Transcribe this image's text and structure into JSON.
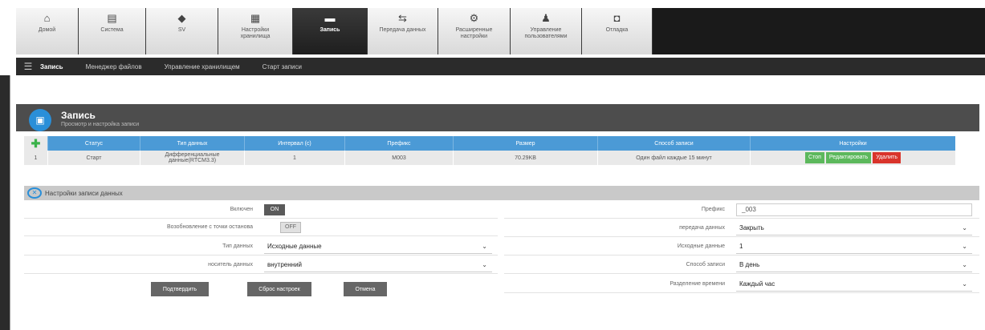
{
  "toolbar": {
    "items": [
      {
        "label": "Домой",
        "icon": "home-icon",
        "glyph": "⌂"
      },
      {
        "label": "Система",
        "icon": "system-icon",
        "glyph": "▤"
      },
      {
        "label": "SV",
        "icon": "sv-icon",
        "glyph": "◆"
      },
      {
        "label": "Настройки хранилища",
        "icon": "storage-icon",
        "glyph": "▦"
      },
      {
        "label": "Запись",
        "icon": "folder-icon",
        "glyph": "▬",
        "active": true
      },
      {
        "label": "Передача данных",
        "icon": "transfer-icon",
        "glyph": "⇆"
      },
      {
        "label": "Расширенные настройки",
        "icon": "settings-icon",
        "glyph": "⚙"
      },
      {
        "label": "Управление пользователями",
        "icon": "users-icon",
        "glyph": "♟"
      },
      {
        "label": "Отладка",
        "icon": "debug-icon",
        "glyph": "◘"
      }
    ]
  },
  "subnav": {
    "items": [
      "Запись",
      "Менеджер файлов",
      "Управление хранилищем",
      "Старт записи"
    ]
  },
  "header": {
    "title": "Запись",
    "subtitle": "Просмотр и настройка записи"
  },
  "table": {
    "columns": [
      "Статус",
      "Тип данных",
      "Интервал (с)",
      "Префикс",
      "Размер",
      "Способ записи",
      "Настройки"
    ],
    "rows": [
      {
        "index": "1",
        "status": "Старт",
        "data_type": "Дифференциальные данные(RTCM3.3)",
        "interval": "1",
        "prefix": "M003",
        "size": "70.29KB",
        "method": "Один файл каждые 15 минут",
        "actions": [
          "Стоп",
          "Редактировать",
          "Удалить"
        ]
      }
    ]
  },
  "settings": {
    "title": "Настройки записи данных",
    "left": {
      "enabled_label": "Включен",
      "enabled_value": "ON",
      "resume_label": "Возобновление с точки останова",
      "resume_value": "OFF",
      "datatype_label": "Тип данных",
      "datatype_value": "Исходные данные",
      "carrier_label": "носитель данных",
      "carrier_value": "внутренний"
    },
    "right": {
      "prefix_label": "Префикс",
      "prefix_value": "_003",
      "transfer_label": "передача данных",
      "transfer_value": "Закрыть",
      "source_label": "Исходные данные",
      "source_value": "1",
      "method_label": "Способ записи",
      "method_value": "В день",
      "split_label": "Разделение времени",
      "split_value": "Каждый час"
    },
    "buttons": {
      "confirm": "Подтвердить",
      "reset": "Сброс настроек",
      "cancel": "Отмена"
    }
  }
}
